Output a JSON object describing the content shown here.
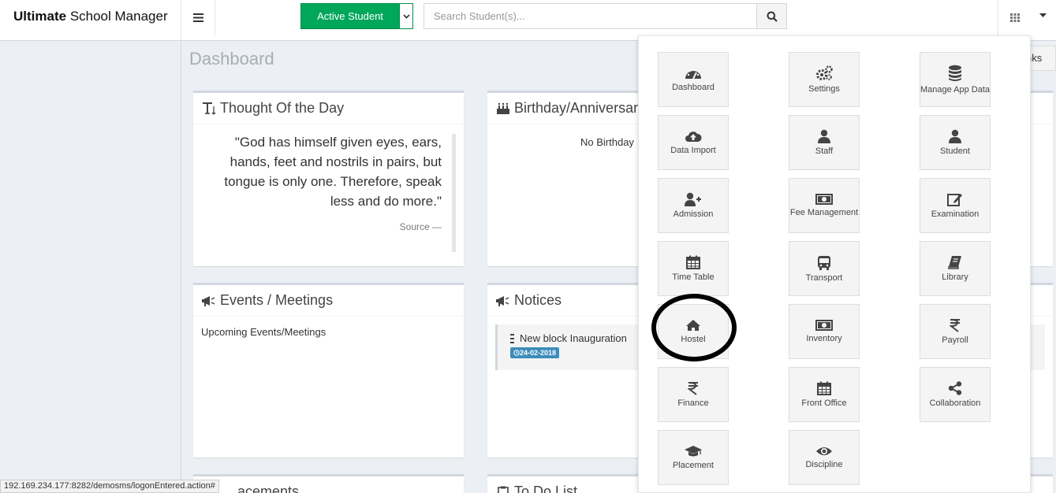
{
  "header": {
    "brand_bold": "Ultimate",
    "brand_rest": "School Manager",
    "active_student_label": "Active Student",
    "search_placeholder": "Search Student(s)..."
  },
  "main": {
    "page_title": "Dashboard",
    "links_button_label": "nks"
  },
  "widgets": {
    "thought": {
      "title": "Thought Of the Day",
      "quote": "\"God has himself given eyes, ears, hands, feet and nostrils in pairs, but tongue is only one. Therefore, speak less and do more.\"",
      "source": "Source —"
    },
    "birthday": {
      "title": "Birthday/Anniversary",
      "empty_text": "No Birthday"
    },
    "events": {
      "title": "Events / Meetings",
      "body": "Upcoming Events/Meetings"
    },
    "notices": {
      "title": "Notices",
      "items": [
        {
          "title": "New block Inauguration",
          "date": "24-02-2018"
        }
      ]
    },
    "bottom_left_title": "acements",
    "bottom_right_title": "To Do List"
  },
  "launcher": {
    "tiles": [
      {
        "label": "Dashboard",
        "icon": "dashboard-icon"
      },
      {
        "label": "Settings",
        "icon": "gears-icon"
      },
      {
        "label": "Manage App Data",
        "icon": "database-icon"
      },
      {
        "label": "Data Import",
        "icon": "cloud-upload-icon"
      },
      {
        "label": "Staff",
        "icon": "user-icon"
      },
      {
        "label": "Student",
        "icon": "user-icon"
      },
      {
        "label": "Admission",
        "icon": "user-plus-icon"
      },
      {
        "label": "Fee Management",
        "icon": "money-icon"
      },
      {
        "label": "Examination",
        "icon": "edit-icon"
      },
      {
        "label": "Time Table",
        "icon": "calendar-icon"
      },
      {
        "label": "Transport",
        "icon": "bus-icon"
      },
      {
        "label": "Library",
        "icon": "book-icon"
      },
      {
        "label": "Hostel",
        "icon": "home-icon"
      },
      {
        "label": "Inventory",
        "icon": "money-icon"
      },
      {
        "label": "Payroll",
        "icon": "rupee-icon"
      },
      {
        "label": "Finance",
        "icon": "rupee-icon"
      },
      {
        "label": "Front Office",
        "icon": "calendar-icon"
      },
      {
        "label": "Collaboration",
        "icon": "share-icon"
      },
      {
        "label": "Placement",
        "icon": "graduation-cap-icon"
      },
      {
        "label": "Discipline",
        "icon": "eye-icon"
      }
    ]
  },
  "statusbar": {
    "url": "192.169.234.177:8282/demosms/logonEntered.action#"
  }
}
